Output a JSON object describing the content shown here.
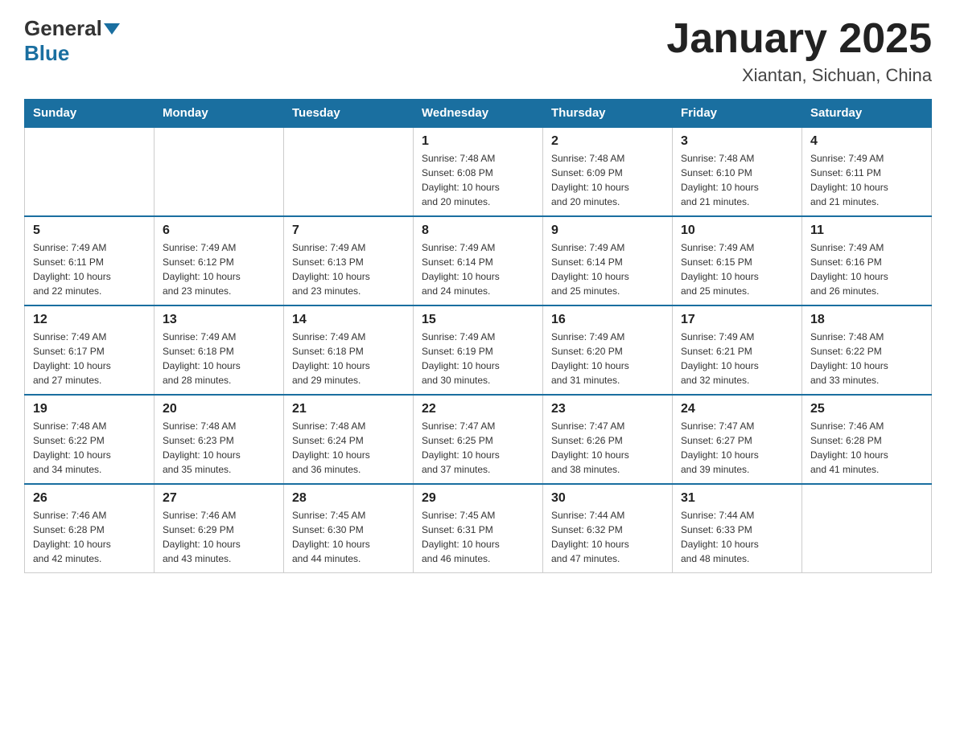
{
  "header": {
    "logo_general": "General",
    "logo_blue": "Blue",
    "title": "January 2025",
    "subtitle": "Xiantan, Sichuan, China"
  },
  "days_of_week": [
    "Sunday",
    "Monday",
    "Tuesday",
    "Wednesday",
    "Thursday",
    "Friday",
    "Saturday"
  ],
  "weeks": [
    [
      {
        "day": "",
        "info": ""
      },
      {
        "day": "",
        "info": ""
      },
      {
        "day": "",
        "info": ""
      },
      {
        "day": "1",
        "info": "Sunrise: 7:48 AM\nSunset: 6:08 PM\nDaylight: 10 hours\nand 20 minutes."
      },
      {
        "day": "2",
        "info": "Sunrise: 7:48 AM\nSunset: 6:09 PM\nDaylight: 10 hours\nand 20 minutes."
      },
      {
        "day": "3",
        "info": "Sunrise: 7:48 AM\nSunset: 6:10 PM\nDaylight: 10 hours\nand 21 minutes."
      },
      {
        "day": "4",
        "info": "Sunrise: 7:49 AM\nSunset: 6:11 PM\nDaylight: 10 hours\nand 21 minutes."
      }
    ],
    [
      {
        "day": "5",
        "info": "Sunrise: 7:49 AM\nSunset: 6:11 PM\nDaylight: 10 hours\nand 22 minutes."
      },
      {
        "day": "6",
        "info": "Sunrise: 7:49 AM\nSunset: 6:12 PM\nDaylight: 10 hours\nand 23 minutes."
      },
      {
        "day": "7",
        "info": "Sunrise: 7:49 AM\nSunset: 6:13 PM\nDaylight: 10 hours\nand 23 minutes."
      },
      {
        "day": "8",
        "info": "Sunrise: 7:49 AM\nSunset: 6:14 PM\nDaylight: 10 hours\nand 24 minutes."
      },
      {
        "day": "9",
        "info": "Sunrise: 7:49 AM\nSunset: 6:14 PM\nDaylight: 10 hours\nand 25 minutes."
      },
      {
        "day": "10",
        "info": "Sunrise: 7:49 AM\nSunset: 6:15 PM\nDaylight: 10 hours\nand 25 minutes."
      },
      {
        "day": "11",
        "info": "Sunrise: 7:49 AM\nSunset: 6:16 PM\nDaylight: 10 hours\nand 26 minutes."
      }
    ],
    [
      {
        "day": "12",
        "info": "Sunrise: 7:49 AM\nSunset: 6:17 PM\nDaylight: 10 hours\nand 27 minutes."
      },
      {
        "day": "13",
        "info": "Sunrise: 7:49 AM\nSunset: 6:18 PM\nDaylight: 10 hours\nand 28 minutes."
      },
      {
        "day": "14",
        "info": "Sunrise: 7:49 AM\nSunset: 6:18 PM\nDaylight: 10 hours\nand 29 minutes."
      },
      {
        "day": "15",
        "info": "Sunrise: 7:49 AM\nSunset: 6:19 PM\nDaylight: 10 hours\nand 30 minutes."
      },
      {
        "day": "16",
        "info": "Sunrise: 7:49 AM\nSunset: 6:20 PM\nDaylight: 10 hours\nand 31 minutes."
      },
      {
        "day": "17",
        "info": "Sunrise: 7:49 AM\nSunset: 6:21 PM\nDaylight: 10 hours\nand 32 minutes."
      },
      {
        "day": "18",
        "info": "Sunrise: 7:48 AM\nSunset: 6:22 PM\nDaylight: 10 hours\nand 33 minutes."
      }
    ],
    [
      {
        "day": "19",
        "info": "Sunrise: 7:48 AM\nSunset: 6:22 PM\nDaylight: 10 hours\nand 34 minutes."
      },
      {
        "day": "20",
        "info": "Sunrise: 7:48 AM\nSunset: 6:23 PM\nDaylight: 10 hours\nand 35 minutes."
      },
      {
        "day": "21",
        "info": "Sunrise: 7:48 AM\nSunset: 6:24 PM\nDaylight: 10 hours\nand 36 minutes."
      },
      {
        "day": "22",
        "info": "Sunrise: 7:47 AM\nSunset: 6:25 PM\nDaylight: 10 hours\nand 37 minutes."
      },
      {
        "day": "23",
        "info": "Sunrise: 7:47 AM\nSunset: 6:26 PM\nDaylight: 10 hours\nand 38 minutes."
      },
      {
        "day": "24",
        "info": "Sunrise: 7:47 AM\nSunset: 6:27 PM\nDaylight: 10 hours\nand 39 minutes."
      },
      {
        "day": "25",
        "info": "Sunrise: 7:46 AM\nSunset: 6:28 PM\nDaylight: 10 hours\nand 41 minutes."
      }
    ],
    [
      {
        "day": "26",
        "info": "Sunrise: 7:46 AM\nSunset: 6:28 PM\nDaylight: 10 hours\nand 42 minutes."
      },
      {
        "day": "27",
        "info": "Sunrise: 7:46 AM\nSunset: 6:29 PM\nDaylight: 10 hours\nand 43 minutes."
      },
      {
        "day": "28",
        "info": "Sunrise: 7:45 AM\nSunset: 6:30 PM\nDaylight: 10 hours\nand 44 minutes."
      },
      {
        "day": "29",
        "info": "Sunrise: 7:45 AM\nSunset: 6:31 PM\nDaylight: 10 hours\nand 46 minutes."
      },
      {
        "day": "30",
        "info": "Sunrise: 7:44 AM\nSunset: 6:32 PM\nDaylight: 10 hours\nand 47 minutes."
      },
      {
        "day": "31",
        "info": "Sunrise: 7:44 AM\nSunset: 6:33 PM\nDaylight: 10 hours\nand 48 minutes."
      },
      {
        "day": "",
        "info": ""
      }
    ]
  ]
}
